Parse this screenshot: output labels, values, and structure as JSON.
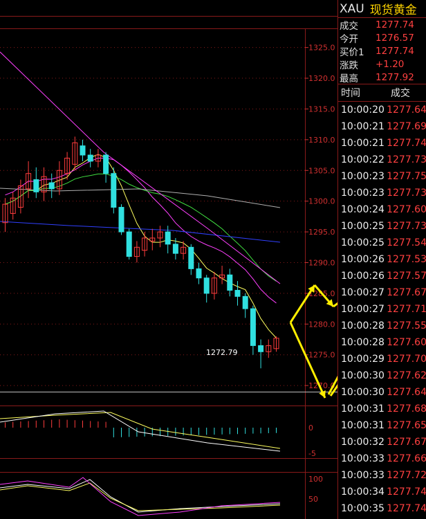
{
  "header": {
    "symbol": "XAU",
    "name": "现货黄金"
  },
  "quote": [
    {
      "label": "成交",
      "value": "1277.74"
    },
    {
      "label": "今开",
      "value": "1276.57"
    },
    {
      "label": "买价1",
      "value": "1277.74"
    },
    {
      "label": "涨跌",
      "value": "+1.20"
    },
    {
      "label": "最高",
      "value": "1277.92"
    }
  ],
  "ticks_header": {
    "time": "时间",
    "price": "成交"
  },
  "ticks": [
    {
      "time": "10:00:20",
      "price": "1277.64"
    },
    {
      "time": "10:00:21",
      "price": "1277.69"
    },
    {
      "time": "10:00:21",
      "price": "1277.74"
    },
    {
      "time": "10:00:22",
      "price": "1277.73"
    },
    {
      "time": "10:00:23",
      "price": "1277.75"
    },
    {
      "time": "10:00:23",
      "price": "1277.73"
    },
    {
      "time": "10:00:24",
      "price": "1277.60"
    },
    {
      "time": "10:00:25",
      "price": "1277.73"
    },
    {
      "time": "10:00:25",
      "price": "1277.54"
    },
    {
      "time": "10:00:26",
      "price": "1277.53"
    },
    {
      "time": "10:00:26",
      "price": "1277.57"
    },
    {
      "time": "10:00:27",
      "price": "1277.67"
    },
    {
      "time": "10:00:27",
      "price": "1277.71"
    },
    {
      "time": "10:00:28",
      "price": "1277.55"
    },
    {
      "time": "10:00:28",
      "price": "1277.60"
    },
    {
      "time": "10:00:29",
      "price": "1277.70"
    },
    {
      "time": "10:00:30",
      "price": "1277.62"
    },
    {
      "time": "10:00:30",
      "price": "1277.64"
    },
    {
      "time": "10:00:31",
      "price": "1277.68"
    },
    {
      "time": "10:00:31",
      "price": "1277.65"
    },
    {
      "time": "10:00:32",
      "price": "1277.67"
    },
    {
      "time": "10:00:33",
      "price": "1277.66"
    },
    {
      "time": "10:00:33",
      "price": "1277.72"
    },
    {
      "time": "10:00:34",
      "price": "1277.74"
    },
    {
      "time": "10:00:35",
      "price": "1277.74"
    }
  ],
  "colors": {
    "up": "#ff3c3c",
    "down": "#30e0e0",
    "grid": "#8a1a1a",
    "axis_text": "#d03030",
    "ma1": "#ffffff",
    "ma2": "#ffff60",
    "ma3": "#ff40ff",
    "ma4": "#40e040",
    "ma5": "#3040ff",
    "ma6": "#b0b0b0",
    "arrow": "#ffee00"
  },
  "chart_data": {
    "type": "candlestick",
    "price_axis": {
      "ticks": [
        "1325.0",
        "1320.0",
        "1315.0",
        "1310.0",
        "1305.0",
        "1300.0",
        "1295.0",
        "1290.0",
        "1285.0",
        "1280.0",
        "1275.0",
        "1270.0"
      ],
      "ylim": [
        1269,
        1328
      ]
    },
    "macd_axis": {
      "ticks": [
        "0",
        "-5"
      ]
    },
    "kdj_axis": {
      "ticks": [
        "100",
        "50"
      ]
    },
    "low_annotation": "1272.79",
    "candles": [
      [
        1296.5,
        1299.5,
        1295.0,
        1300.5
      ],
      [
        1298.0,
        1300.5,
        1297.0,
        1301.5
      ],
      [
        1299.0,
        1302.5,
        1298.0,
        1303.5
      ],
      [
        1302.0,
        1304.5,
        1300.5,
        1306.5
      ],
      [
        1303.5,
        1301.5,
        1300.5,
        1305.5
      ],
      [
        1301.5,
        1304.0,
        1300.0,
        1305.5
      ],
      [
        1303.0,
        1302.0,
        1300.5,
        1304.5
      ],
      [
        1302.0,
        1305.0,
        1301.0,
        1306.5
      ],
      [
        1304.5,
        1307.0,
        1303.5,
        1308.0
      ],
      [
        1306.0,
        1309.5,
        1305.0,
        1310.5
      ],
      [
        1309.0,
        1307.5,
        1306.5,
        1310.0
      ],
      [
        1307.5,
        1306.5,
        1305.5,
        1308.5
      ],
      [
        1306.5,
        1307.5,
        1305.5,
        1308.5
      ],
      [
        1307.5,
        1304.5,
        1303.0,
        1308.0
      ],
      [
        1304.5,
        1299.0,
        1298.0,
        1305.5
      ],
      [
        1299.0,
        1295.0,
        1294.5,
        1299.5
      ],
      [
        1295.0,
        1291.0,
        1290.5,
        1295.5
      ],
      [
        1291.0,
        1292.5,
        1290.0,
        1293.5
      ],
      [
        1292.0,
        1294.0,
        1291.0,
        1295.0
      ],
      [
        1293.5,
        1294.0,
        1292.0,
        1295.5
      ],
      [
        1294.0,
        1295.0,
        1292.5,
        1296.0
      ],
      [
        1295.0,
        1293.0,
        1291.5,
        1296.0
      ],
      [
        1293.0,
        1291.5,
        1290.5,
        1294.0
      ],
      [
        1291.5,
        1292.5,
        1290.5,
        1293.5
      ],
      [
        1292.5,
        1289.0,
        1288.0,
        1293.0
      ],
      [
        1289.0,
        1287.5,
        1286.5,
        1290.0
      ],
      [
        1287.5,
        1285.0,
        1283.5,
        1288.0
      ],
      [
        1285.0,
        1287.5,
        1284.0,
        1288.5
      ],
      [
        1287.5,
        1288.0,
        1286.5,
        1289.5
      ],
      [
        1288.0,
        1285.5,
        1284.5,
        1289.0
      ],
      [
        1285.5,
        1284.5,
        1283.0,
        1287.0
      ],
      [
        1284.5,
        1282.5,
        1281.0,
        1285.0
      ],
      [
        1282.5,
        1276.5,
        1275.0,
        1283.0
      ],
      [
        1276.5,
        1275.5,
        1272.8,
        1277.5
      ],
      [
        1275.5,
        1276.5,
        1274.5,
        1277.5
      ],
      [
        1276.0,
        1277.7,
        1275.5,
        1278.0
      ]
    ]
  }
}
